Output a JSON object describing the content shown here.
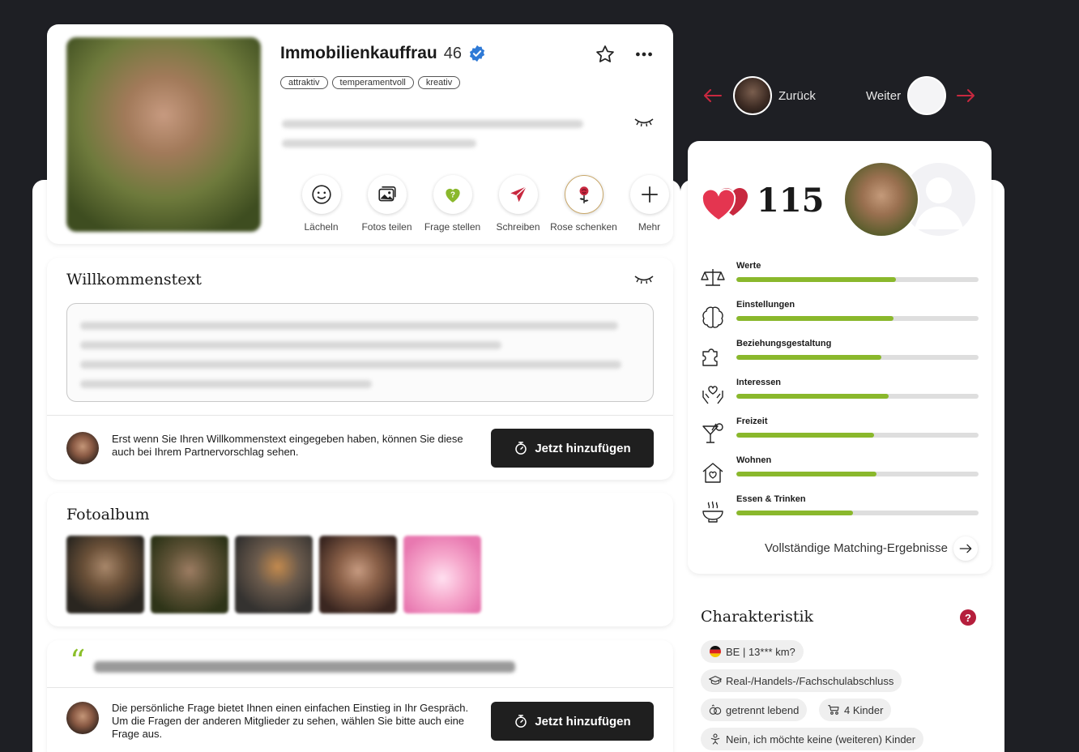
{
  "profile": {
    "name": "Immobilienkauffrau",
    "age": "46",
    "tags": [
      "attraktiv",
      "temperamentvoll",
      "kreativ"
    ],
    "actions": [
      {
        "label": "Lächeln",
        "icon": "smile-icon"
      },
      {
        "label": "Fotos teilen",
        "icon": "photos-icon"
      },
      {
        "label": "Frage stellen",
        "icon": "question-heart-icon"
      },
      {
        "label": "Schreiben",
        "icon": "send-icon"
      },
      {
        "label": "Rose schenken",
        "icon": "rose-icon"
      },
      {
        "label": "Mehr",
        "icon": "plus-icon"
      }
    ]
  },
  "welcome": {
    "title": "Willkommenstext",
    "hint": "Erst wenn Sie Ihren Willkommenstext eingegeben haben, können Sie diese auch bei Ihrem Partnervorschlag sehen.",
    "button": "Jetzt hinzufügen"
  },
  "album": {
    "title": "Fotoalbum",
    "photos": [
      "photo-1",
      "photo-2",
      "photo-3",
      "photo-4",
      "photo-5"
    ]
  },
  "question": {
    "hint": "Die persönliche Frage bietet Ihnen einen einfachen Einstieg in Ihr Gespräch. Um die Fragen der anderen Mitglieder zu sehen, wählen Sie bitte auch eine Frage aus.",
    "button": "Jetzt hinzufügen"
  },
  "nav": {
    "back": "Zurück",
    "next": "Weiter"
  },
  "matching": {
    "score": "115",
    "categories": [
      {
        "label": "Werte",
        "value": 0.66,
        "icon": "scales-icon"
      },
      {
        "label": "Einstellungen",
        "value": 0.65,
        "icon": "brain-icon"
      },
      {
        "label": "Beziehungsgestaltung",
        "value": 0.6,
        "icon": "puzzle-icon"
      },
      {
        "label": "Interessen",
        "value": 0.63,
        "icon": "hands-heart-icon"
      },
      {
        "label": "Freizeit",
        "value": 0.57,
        "icon": "cocktail-icon"
      },
      {
        "label": "Wohnen",
        "value": 0.58,
        "icon": "house-heart-icon"
      },
      {
        "label": "Essen & Trinken",
        "value": 0.48,
        "icon": "bowl-icon"
      }
    ],
    "full_results": "Vollständige Matching-Ergebnisse"
  },
  "characteristics": {
    "title": "Charakteristik",
    "help": "?",
    "chips": [
      {
        "text": "BE | 13*** km?",
        "icon": "flag-de-icon"
      },
      {
        "text": "Real-/Handels-/Fachschulabschluss",
        "icon": "graduation-icon"
      },
      {
        "text": "getrennt lebend",
        "icon": "rings-icon"
      },
      {
        "text": "4 Kinder",
        "icon": "stroller-icon"
      },
      {
        "text": "Nein, ich möchte keine (weiteren) Kinder",
        "icon": "child-icon"
      }
    ]
  },
  "colors": {
    "accent_green": "#8ab82c",
    "brand_red": "#b51e3c",
    "button_dark": "#1f1f1f",
    "verified_blue": "#2f7ad6"
  }
}
